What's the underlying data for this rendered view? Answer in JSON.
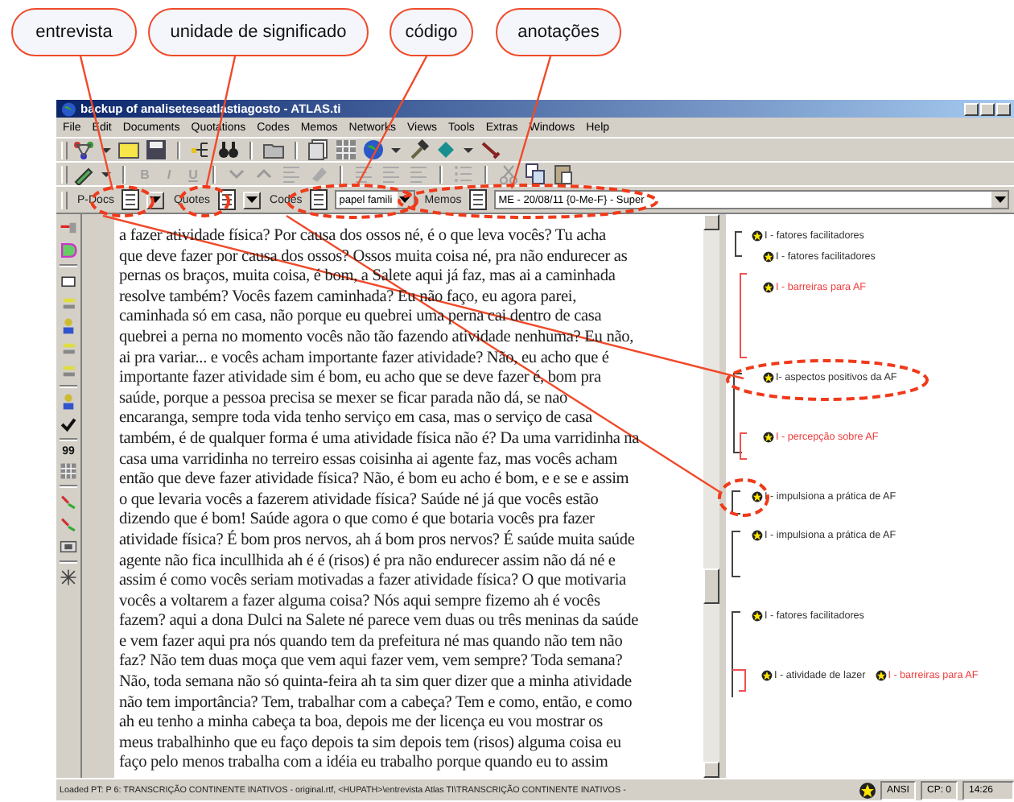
{
  "callouts": [
    {
      "text": "entrevista"
    },
    {
      "text": "unidade de significado"
    },
    {
      "text": "código"
    },
    {
      "text": "anotações"
    }
  ],
  "window": {
    "title": "backup of analiseteseatlastiagosto - ATLAS.ti"
  },
  "menu": [
    "File",
    "Edit",
    "Documents",
    "Quotations",
    "Codes",
    "Memos",
    "Networks",
    "Views",
    "Tools",
    "Extras",
    "Windows",
    "Help"
  ],
  "format_buttons": [
    {
      "label": "B",
      "disabled": true
    },
    {
      "label": "I",
      "disabled": true
    },
    {
      "label": "U",
      "disabled": true
    }
  ],
  "selectors": {
    "pdocs": {
      "label": "P-Docs"
    },
    "quotes": {
      "label": "Quotes"
    },
    "codes": {
      "label": "Codes",
      "value": "papel famili"
    },
    "memos": {
      "label": "Memos",
      "value": "ME - 20/08/11 {0-Me-F} - Super"
    }
  },
  "left_toolbar": {
    "quote_button": "99"
  },
  "document": {
    "lines": [
      "a fazer atividade física? Por causa dos ossos né,  é o que leva vocês? Tu acha",
      "que deve fazer por causa dos ossos? Ossos muita coisa né, pra não endurecer as",
      "pernas os braços, muita coisa, é bom, a Salete aqui já faz, mas ai a caminhada",
      "resolve também? Vocês fazem caminhada? Eu não faço, eu agora parei,",
      "caminhada só em casa, não porque eu quebrei uma perna cai dentro de casa",
      "quebrei a perna no momento vocês não tão fazendo atividade nenhuma? Eu não,",
      "ai pra variar... e vocês acham importante fazer atividade? Não, eu acho que é",
      "importante fazer atividade sim é bom, eu acho que se deve fazer é, bom pra",
      "saúde, porque a pessoa precisa se mexer se ficar parada não dá, se nao",
      "encaranga, sempre toda vida tenho serviço em casa, mas o serviço de casa",
      "também, é de qualquer forma é uma atividade física não é? Da uma varridinha na",
      "casa uma varridinha no terreiro essas coisinha ai agente faz, mas vocês acham",
      "então que deve fazer atividade física? Não, é bom eu acho é bom, e e se e assim",
      "o que levaria vocês a fazerem atividade física? Saúde né já que vocês estão",
      "dizendo que é bom! Saúde agora o que como é que botaria vocês pra fazer",
      "atividade física? É bom pros nervos, ah á bom pros nervos? É saúde muita saúde",
      "agente não fica incullhida ah é é (risos) é pra não endurecer assim não dá né e",
      "assim é como vocês seriam motivadas a fazer atividade física? O que motivaria",
      "vocês a voltarem a fazer alguma coisa? Nós aqui sempre fizemo ah é vocês",
      "fazem? aqui a dona Dulci na Salete né parece vem duas ou três meninas da saúde",
      "e vem fazer aqui pra nós quando tem da prefeitura né mas quando não tem não",
      "faz? Não tem duas moça que vem aqui fazer vem, vem sempre? Toda semana?",
      "Não, toda semana não só quinta-feira ah ta sim quer dizer que a minha atividade",
      "não tem importância? Tem, trabalhar com a cabeça? Tem e como, então, e como",
      "ah eu tenho a minha cabeça ta boa, depois me der licença eu vou mostrar os",
      "meus trabalhinho que eu faço depois ta sim depois tem (risos) alguma coisa eu",
      "faço pelo menos trabalha com a idéia eu trabalho porque quando eu to assim"
    ]
  },
  "margin": [
    {
      "codes": [
        {
          "label": "I - fatores facilitadores",
          "color": "#333333"
        }
      ]
    },
    {
      "codes": [
        {
          "label": "I - fatores facilitadores",
          "color": "#333333"
        }
      ]
    },
    {
      "codes": [
        {
          "label": "I -  barreiras  para AF",
          "color": "#f03c3c"
        }
      ]
    },
    {
      "codes": [
        {
          "label": "I-  aspectos positivos da AF",
          "color": "#333333"
        }
      ]
    },
    {
      "codes": [
        {
          "label": "I - percepção sobre AF",
          "color": "#f03c3c"
        }
      ]
    },
    {
      "codes": [
        {
          "label": "I - impulsiona a prática de AF",
          "color": "#333333"
        }
      ]
    },
    {
      "codes": [
        {
          "label": "I - impulsiona a prática de AF",
          "color": "#333333"
        }
      ]
    },
    {
      "codes": [
        {
          "label": "I - fatores facilitadores",
          "color": "#333333"
        }
      ]
    },
    {
      "codes": [
        {
          "label": "I - atividade de lazer",
          "color": "#333333"
        },
        {
          "label": "I -  barreiras  para AF",
          "color": "#f03c3c"
        }
      ]
    }
  ],
  "status_bar": {
    "path": "Loaded PT: P 6: TRANSCRIÇÃO CONTINENTE INATIVOS - original.rtf, <HUPATH>\\entrevista Atlas TI\\TRANSCRIÇÃO CONTINENTE INATIVOS -",
    "encoding": "ANSI",
    "cp": "CP: 0",
    "time": "14:26"
  }
}
